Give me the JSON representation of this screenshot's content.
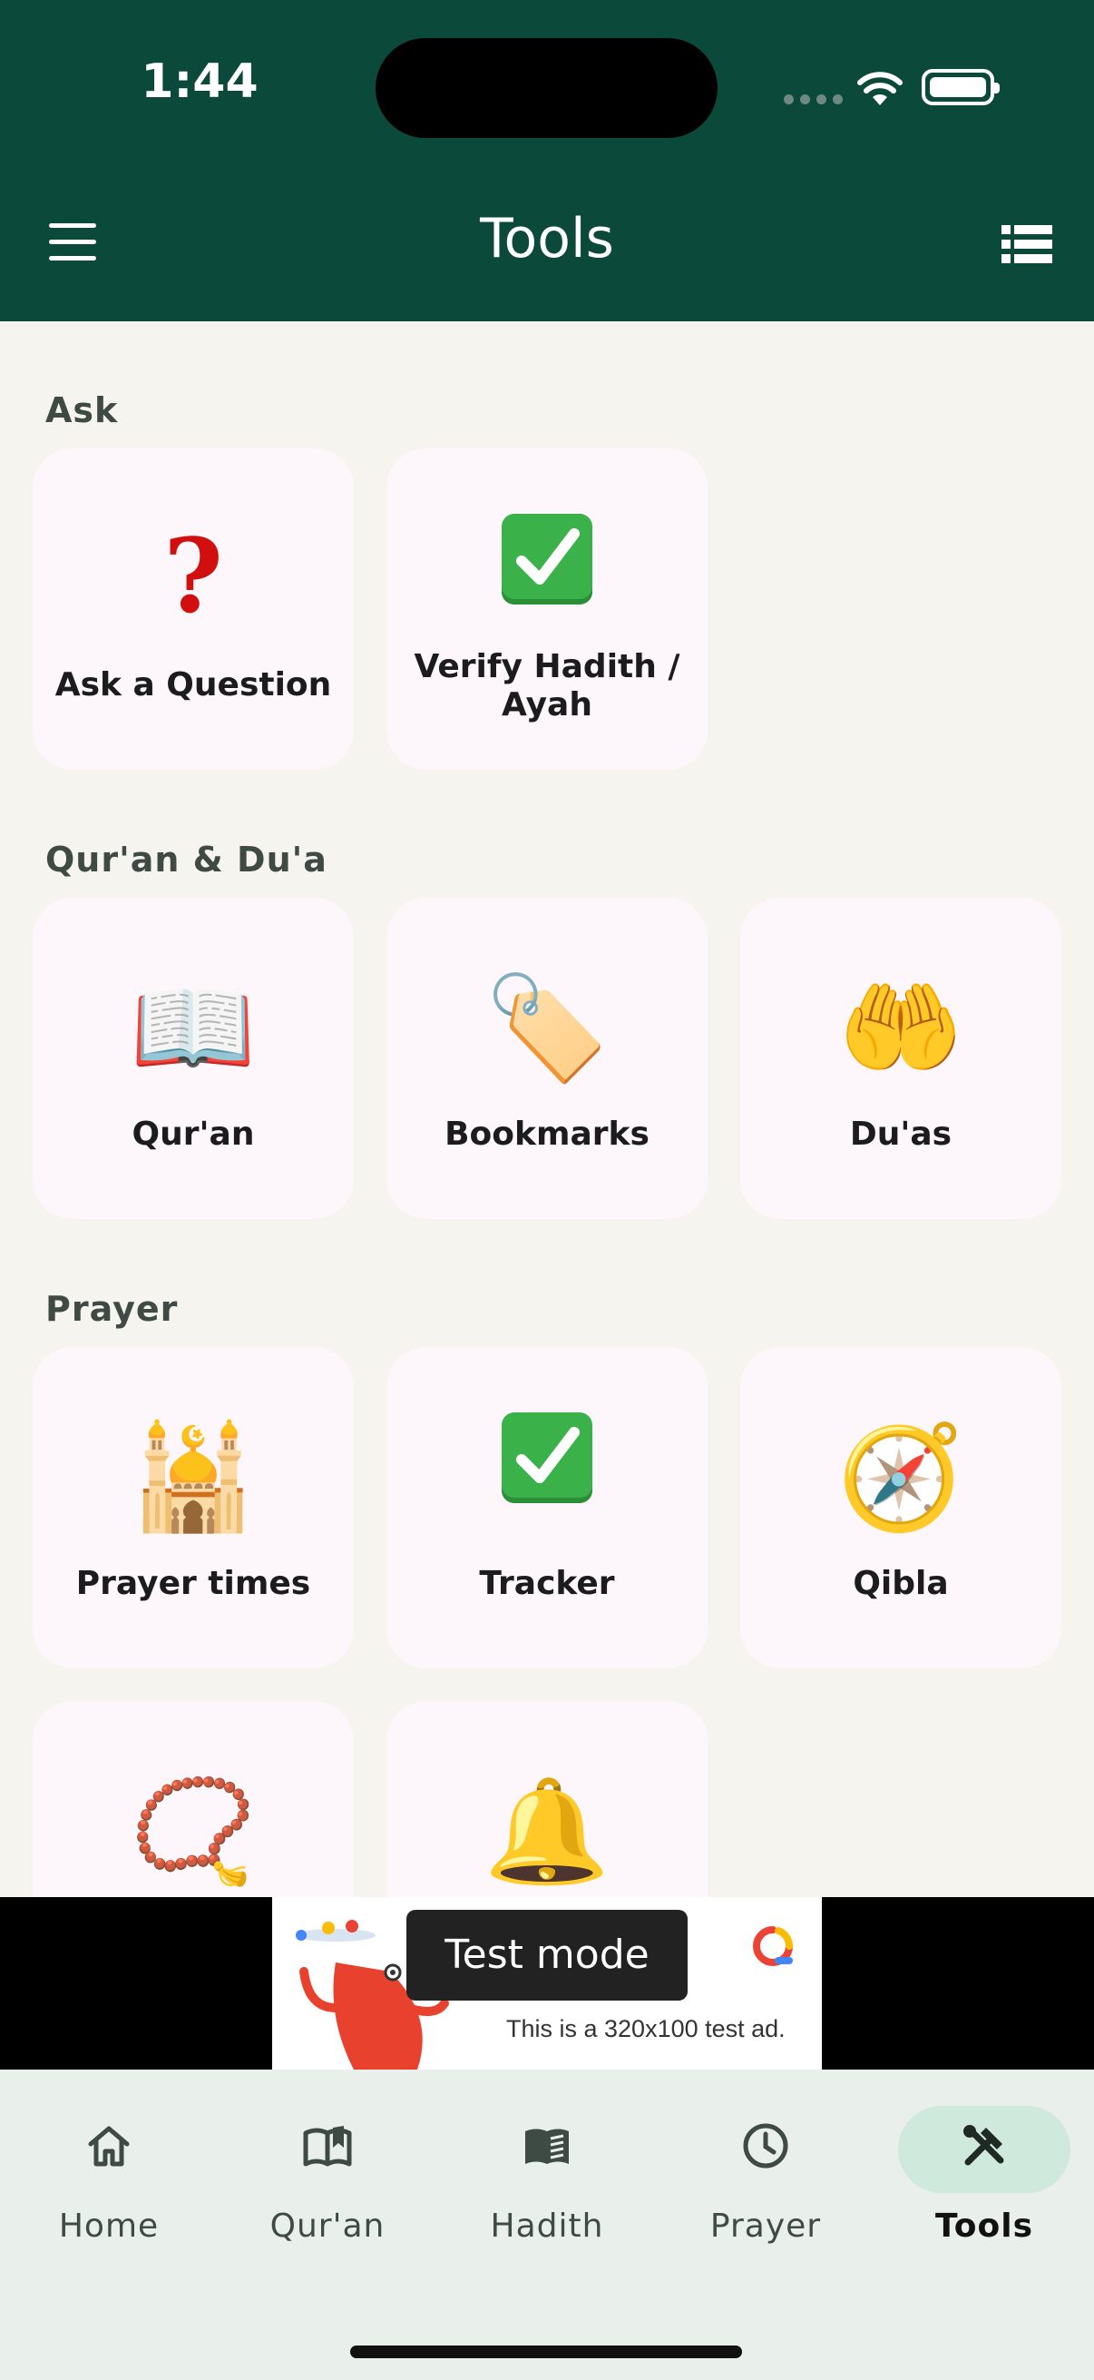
{
  "status_bar": {
    "time": "1:44"
  },
  "header": {
    "title": "Tools"
  },
  "sections": [
    {
      "title": "Ask",
      "items": [
        {
          "label": "Ask a Question",
          "icon": "question-mark-icon"
        },
        {
          "label": "Verify Hadith / Ayah",
          "icon": "check-mark-icon"
        }
      ]
    },
    {
      "title": "Qur'an & Du'a",
      "items": [
        {
          "label": "Qur'an",
          "icon": "open-book-icon",
          "emoji": "📖"
        },
        {
          "label": "Bookmarks",
          "icon": "bookmark-tag-icon",
          "emoji": "🏷️"
        },
        {
          "label": "Du'as",
          "icon": "palms-up-icon",
          "emoji": "🤲"
        }
      ]
    },
    {
      "title": "Prayer",
      "items": [
        {
          "label": "Prayer times",
          "icon": "mosque-icon",
          "emoji": "🕌"
        },
        {
          "label": "Tracker",
          "icon": "check-mark-icon"
        },
        {
          "label": "Qibla",
          "icon": "compass-icon",
          "emoji": "🧭"
        },
        {
          "label": "",
          "icon": "prayer-beads-icon",
          "emoji": "📿"
        },
        {
          "label": "",
          "icon": "bell-icon",
          "emoji": "🔔"
        }
      ]
    }
  ],
  "ad": {
    "text": "This is a 320x100 test ad.",
    "toast": "Test mode"
  },
  "nav": {
    "items": [
      {
        "label": "Home",
        "icon": "home-icon"
      },
      {
        "label": "Qur'an",
        "icon": "quran-book-icon"
      },
      {
        "label": "Hadith",
        "icon": "hadith-book-icon"
      },
      {
        "label": "Prayer",
        "icon": "clock-icon"
      },
      {
        "label": "Tools",
        "icon": "tools-icon",
        "active": true
      }
    ]
  },
  "colors": {
    "header_bg": "#0B4A3A",
    "page_bg": "#F6F4EF",
    "tile_bg": "#FDF7FC",
    "nav_bg": "#E9EFEA",
    "active_pill": "#CFE9DC"
  }
}
